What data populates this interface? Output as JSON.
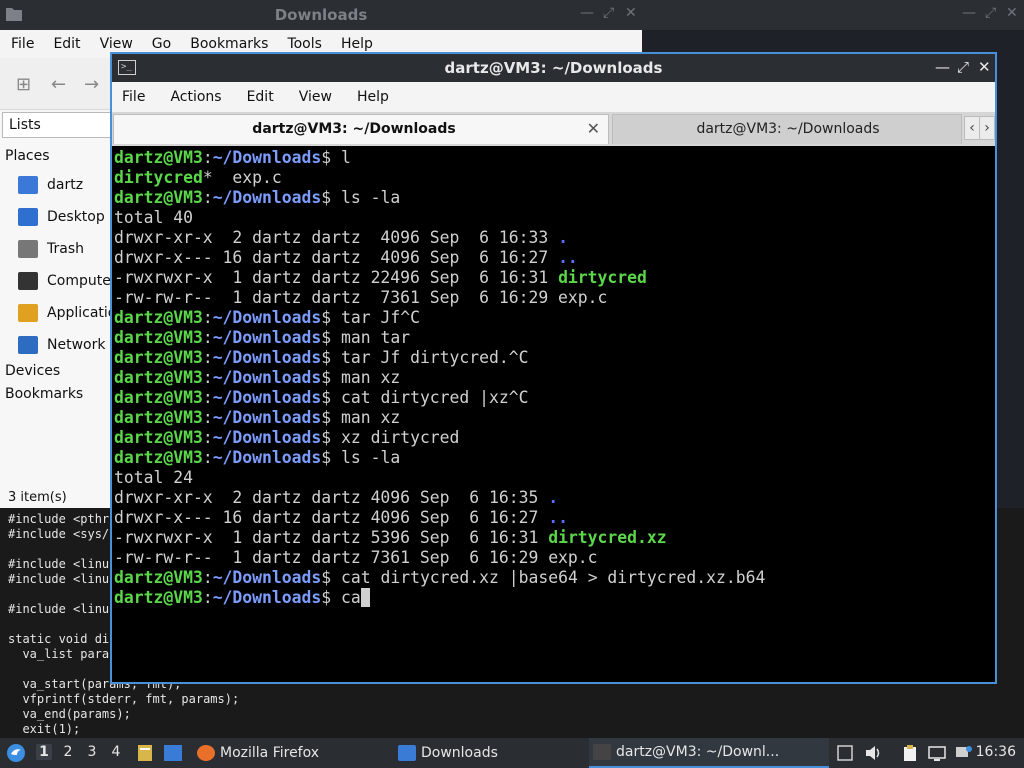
{
  "editor": {
    "lines": [
      "#include <pthr",
      "#include <sys/",
      "",
      "#include <linu",
      "#include <linu",
      "",
      "#include <linu",
      "",
      "static void di",
      "  va_list para",
      "",
      "  va_start(params, fmt);",
      "  vfprintf(stderr, fmt, params);",
      "  va_end(params);",
      "  exit(1);"
    ]
  },
  "file_manager": {
    "title": "Downloads",
    "menu": [
      "File",
      "Edit",
      "View",
      "Go",
      "Bookmarks",
      "Tools",
      "Help"
    ],
    "sidebar_mode": "Lists",
    "places_header": "Places",
    "places": [
      {
        "label": "dartz",
        "icon": "home-folder-icon",
        "color": "#3c78d8"
      },
      {
        "label": "Desktop",
        "icon": "desktop-icon",
        "color": "#2f6fd0"
      },
      {
        "label": "Trash",
        "icon": "trash-icon",
        "color": "#777777"
      },
      {
        "label": "Compute",
        "icon": "computer-icon",
        "color": "#333333"
      },
      {
        "label": "Applicatio",
        "icon": "applications-icon",
        "color": "#e0a020"
      },
      {
        "label": "Network",
        "icon": "network-icon",
        "color": "#2d6cc0"
      }
    ],
    "devices_header": "Devices",
    "bookmarks_header": "Bookmarks",
    "status": "3 item(s)"
  },
  "terminal": {
    "window_title": "dartz@VM3: ~/Downloads",
    "menu": [
      "File",
      "Actions",
      "Edit",
      "View",
      "Help"
    ],
    "tabs": [
      {
        "label": "dartz@VM3: ~/Downloads",
        "active": true
      },
      {
        "label": "dartz@VM3: ~/Downloads",
        "active": false
      }
    ],
    "prompt_user": "dartz@VM3",
    "prompt_sep": ":",
    "prompt_path": "~/Downloads",
    "prompt_end": "$ ",
    "lines": [
      {
        "type": "cmd",
        "text": "l"
      },
      {
        "type": "out",
        "segs": [
          {
            "t": "dirtycred",
            "c": "exec"
          },
          {
            "t": "*  exp.c",
            "c": ""
          }
        ]
      },
      {
        "type": "cmd",
        "text": "ls -la"
      },
      {
        "type": "out",
        "segs": [
          {
            "t": "total 40",
            "c": ""
          }
        ]
      },
      {
        "type": "out",
        "segs": [
          {
            "t": "drwxr-xr-x  2 dartz dartz  4096 Sep  6 16:33 ",
            "c": ""
          },
          {
            "t": ".",
            "c": "dir"
          }
        ]
      },
      {
        "type": "out",
        "segs": [
          {
            "t": "drwxr-x--- 16 dartz dartz  4096 Sep  6 16:27 ",
            "c": ""
          },
          {
            "t": "..",
            "c": "dir"
          }
        ]
      },
      {
        "type": "out",
        "segs": [
          {
            "t": "-rwxrwxr-x  1 dartz dartz 22496 Sep  6 16:31 ",
            "c": ""
          },
          {
            "t": "dirtycred",
            "c": "exec"
          }
        ]
      },
      {
        "type": "out",
        "segs": [
          {
            "t": "-rw-rw-r--  1 dartz dartz  7361 Sep  6 16:29 exp.c",
            "c": ""
          }
        ]
      },
      {
        "type": "cmd",
        "text": "tar Jf^C"
      },
      {
        "type": "cmd",
        "text": "man tar"
      },
      {
        "type": "cmd",
        "text": "tar Jf dirtycred.^C"
      },
      {
        "type": "cmd",
        "text": "man xz"
      },
      {
        "type": "cmd",
        "text": "cat dirtycred |xz^C"
      },
      {
        "type": "cmd",
        "text": "man xz"
      },
      {
        "type": "cmd",
        "text": "xz dirtycred"
      },
      {
        "type": "cmd",
        "text": "ls -la"
      },
      {
        "type": "out",
        "segs": [
          {
            "t": "total 24",
            "c": ""
          }
        ]
      },
      {
        "type": "out",
        "segs": [
          {
            "t": "drwxr-xr-x  2 dartz dartz 4096 Sep  6 16:35 ",
            "c": ""
          },
          {
            "t": ".",
            "c": "dir"
          }
        ]
      },
      {
        "type": "out",
        "segs": [
          {
            "t": "drwxr-x--- 16 dartz dartz 4096 Sep  6 16:27 ",
            "c": ""
          },
          {
            "t": "..",
            "c": "dir"
          }
        ]
      },
      {
        "type": "out",
        "segs": [
          {
            "t": "-rwxrwxr-x  1 dartz dartz 5396 Sep  6 16:31 ",
            "c": ""
          },
          {
            "t": "dirtycred.xz",
            "c": "exec"
          }
        ]
      },
      {
        "type": "out",
        "segs": [
          {
            "t": "-rw-rw-r--  1 dartz dartz 7361 Sep  6 16:29 exp.c",
            "c": ""
          }
        ]
      },
      {
        "type": "cmd",
        "text": "cat dirtycred.xz |base64 > dirtycred.xz.b64"
      },
      {
        "type": "cmd",
        "text": "ca",
        "cursor": true
      }
    ]
  },
  "taskbar": {
    "workspaces": [
      "1",
      "2",
      "3",
      "4"
    ],
    "active_workspace": "1",
    "tasks": [
      {
        "label": "Mozilla Firefox",
        "icon": "firefox-icon"
      },
      {
        "label": "Downloads",
        "icon": "folder-icon"
      },
      {
        "label": "dartz@VM3: ~/Downl...",
        "icon": "terminal-icon"
      }
    ],
    "clock": "16:36"
  },
  "colors": {
    "accent": "#4a90d9",
    "prompt_user": "#5bd84a",
    "prompt_path": "#7c9dff",
    "executable": "#5bd84a",
    "directory": "#5d6fff"
  }
}
